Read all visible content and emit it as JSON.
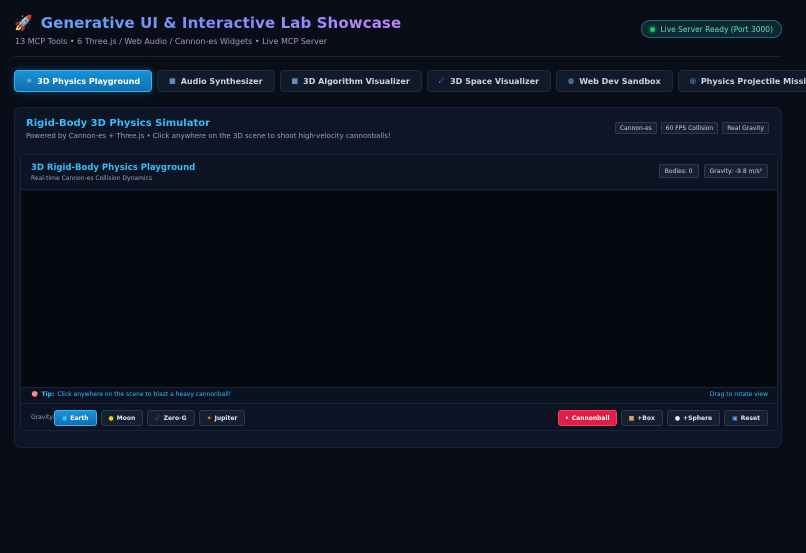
{
  "header": {
    "title": "Generative UI & Interactive Lab Showcase",
    "subtitle": "13 MCP Tools • 6 Three.js / Web Audio / Cannon-es Widgets • Live MCP Server",
    "server_status": "Live Server Ready (Port 3000)",
    "icon": "rocket-icon"
  },
  "tabs": [
    {
      "label": "3D Physics Playground",
      "icon": "atom-icon",
      "glyph": "⚛",
      "active": true
    },
    {
      "label": "Audio Synthesizer",
      "icon": "keyboard-icon",
      "glyph": "▦",
      "active": false
    },
    {
      "label": "3D Algorithm Visualizer",
      "icon": "chart-icon",
      "glyph": "▩",
      "active": false
    },
    {
      "label": "3D Space Visualizer",
      "icon": "comet-icon",
      "glyph": "☄",
      "active": false
    },
    {
      "label": "Web Dev Sandbox",
      "icon": "globe-icon",
      "glyph": "◍",
      "active": false
    },
    {
      "label": "Physics Projectile Mission",
      "icon": "target-icon",
      "glyph": "◎",
      "active": false
    }
  ],
  "panel": {
    "title": "Rigid-Body 3D Physics Simulator",
    "subtitle": "Powered by Cannon-es + Three.js • Click anywhere on the 3D scene to shoot high-velocity cannonballs!",
    "badges": [
      "Cannon-es",
      "60 FPS Collision",
      "Real Gravity"
    ]
  },
  "playground": {
    "title": "3D Rigid-Body Physics Playground",
    "subtitle": "Real-time Cannon-es Collision Dynamics",
    "bodies_label": "Bodies: 0",
    "gravity_label": "Gravity: -9.8 m/s²",
    "tip_label": "Tip:",
    "tip_text": "Click anywhere on the scene to blast a heavy cannonball!",
    "drag_hint": "Drag to rotate view"
  },
  "controls": {
    "gravity_label": "Gravity:",
    "gravity_options": [
      {
        "label": "Earth",
        "glyph": "●",
        "icon": "earth-icon",
        "color": "#38bdf8",
        "active": true
      },
      {
        "label": "Moon",
        "glyph": "●",
        "icon": "moon-icon",
        "color": "#facc15",
        "active": false
      },
      {
        "label": "Zero-G",
        "glyph": "☄",
        "icon": "rocket-icon",
        "color": "#93c5fd",
        "active": false
      },
      {
        "label": "Jupiter",
        "glyph": "✦",
        "icon": "planet-icon",
        "color": "#fb923c",
        "active": false
      }
    ],
    "actions": [
      {
        "label": "Cannonball",
        "glyph": "•",
        "icon": "cannonball-icon",
        "variant": "red"
      },
      {
        "label": "+Box",
        "glyph": "■",
        "icon": "box-icon",
        "color": "#d6a36b",
        "variant": "default"
      },
      {
        "label": "+Sphere",
        "glyph": "●",
        "icon": "sphere-icon",
        "color": "#f1f5f9",
        "variant": "default"
      },
      {
        "label": "Reset",
        "glyph": "▣",
        "icon": "reset-icon",
        "color": "#60a5fa",
        "variant": "default"
      }
    ]
  }
}
